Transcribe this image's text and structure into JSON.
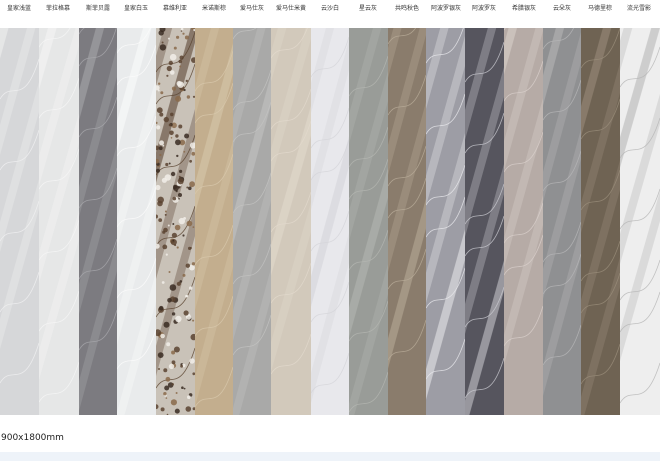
{
  "swatch_labels": [
    "皇家浅蓝",
    "菲拉格慕",
    "斯菲贝露",
    "皇家白玉",
    "慕维利亚",
    "米诺斯棕",
    "爱马仕灰",
    "爱马仕米黄",
    "云沙白",
    "星云灰",
    "共鸣秋色",
    "阿波罗银灰",
    "阿波罗灰",
    "希腊银灰",
    "云朵灰",
    "马德里棕",
    "流光雪影"
  ],
  "swatches": [
    {
      "name": "皇家浅蓝",
      "base": "#d6d7d9",
      "vein": "#f0f0f1"
    },
    {
      "name": "菲拉格慕",
      "base": "#e6e7e7",
      "vein": "#f6f6f6"
    },
    {
      "name": "斯菲贝露",
      "base": "#7c7b80",
      "vein": "#a8a8ab"
    },
    {
      "name": "皇家白玉",
      "base": "#e9ebec",
      "vein": "#fbfbfb"
    },
    {
      "name": "慕维利亚",
      "base": "#c9c2b8",
      "vein": "#5a4330"
    },
    {
      "name": "米诺斯棕",
      "base": "#c3ae8e",
      "vein": "#d8c8ad"
    },
    {
      "name": "爱马仕灰",
      "base": "#a9a9a8",
      "vein": "#c3c3c2"
    },
    {
      "name": "爱马仕米黄",
      "base": "#d2c9bb",
      "vein": "#e2dacd"
    },
    {
      "name": "云沙白",
      "base": "#e8e8ec",
      "vein": "#d5d5da"
    },
    {
      "name": "星云灰",
      "base": "#999c98",
      "vein": "#b4b6b2"
    },
    {
      "name": "共鸣秋色",
      "base": "#8a7c6c",
      "vein": "#b8ab99"
    },
    {
      "name": "阿波罗银灰",
      "base": "#9d9da5",
      "vein": "#e8e8ec"
    },
    {
      "name": "阿波罗灰",
      "base": "#56555e",
      "vein": "#c9c9cf"
    },
    {
      "name": "希腊银灰",
      "base": "#b6aba6",
      "vein": "#d9d0cc"
    },
    {
      "name": "云朵灰",
      "base": "#8f9092",
      "vein": "#b6b6b8"
    },
    {
      "name": "马德里棕",
      "base": "#6f6353",
      "vein": "#9a8d7a"
    },
    {
      "name": "流光雪影",
      "base": "#eeeeee",
      "vein": "#b5b5b5"
    }
  ],
  "size_caption": "900x1800mm"
}
